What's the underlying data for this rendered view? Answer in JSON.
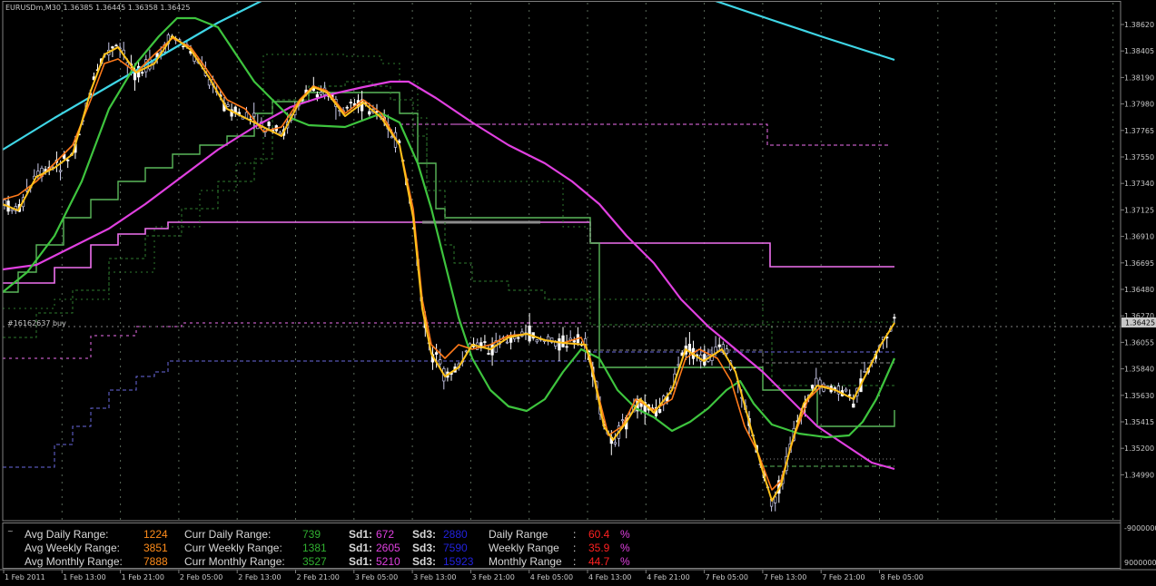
{
  "chart_header": "EURUSDm,M30  1.36385 1.36445 1.36358 1.36425",
  "order_label": "#16162637 buy",
  "current_price": "1.36425",
  "indicator_panel_marker": "~",
  "colors": {
    "background": "#000000",
    "bull_candle": "#c8c8e8",
    "bear_candle": "#ffffff",
    "cyan_ma": "#3fd6e6",
    "magenta_ma": "#e040e0",
    "green_ma": "#3ec43e",
    "yellow_ma": "#ffc21a",
    "orange_ma": "#ff7a1a",
    "pink_level": "#f070f0",
    "green_level": "#5ab85a",
    "dark_green_level": "#2e7a2e",
    "blue_level": "#6a6ae0",
    "grey_level": "#8c8c8c",
    "panel_orange": "#ff8c1a",
    "panel_green": "#30b030",
    "panel_magenta": "#e040e0",
    "panel_blue": "#2222dd",
    "panel_red": "#ff2020",
    "panel_label_white": "#d8d8d8"
  },
  "price_axis": {
    "labels": [
      "1.38620",
      "1.38405",
      "1.38190",
      "1.37980",
      "1.37765",
      "1.37550",
      "1.37340",
      "1.37125",
      "1.36910",
      "1.36695",
      "1.36480",
      "1.36270",
      "1.36055",
      "1.35840",
      "1.35630",
      "1.35415",
      "1.35200",
      "1.34990"
    ]
  },
  "indicator_axis": {
    "labels": [
      "-9000000",
      "9000000"
    ]
  },
  "time_axis": {
    "labels": [
      "1 Feb 2011",
      "1 Feb 13:00",
      "1 Feb 21:00",
      "2 Feb 05:00",
      "2 Feb 13:00",
      "2 Feb 21:00",
      "3 Feb 05:00",
      "3 Feb 13:00",
      "3 Feb 21:00",
      "4 Feb 05:00",
      "4 Feb 13:00",
      "4 Feb 21:00",
      "7 Feb 05:00",
      "7 Feb 13:00",
      "7 Feb 21:00",
      "8 Feb 05:00"
    ]
  },
  "panel": {
    "rows": [
      {
        "avg_label": "Avg Daily Range:",
        "avg_value": "1224",
        "curr_label": "Curr Daily Range:",
        "curr_value": "739",
        "sd1_label": "Sd1:",
        "sd1_value": "672",
        "sd3_label": "Sd3:",
        "sd3_value": "2880",
        "pct_label": "Daily Range",
        "pct_colon": ":",
        "pct_value": "60.4",
        "pct_unit": "%"
      },
      {
        "avg_label": "Avg Weekly Range:",
        "avg_value": "3851",
        "curr_label": "Curr Weekly Range:",
        "curr_value": "1381",
        "sd1_label": "Sd1:",
        "sd1_value": "2605",
        "sd3_label": "Sd3:",
        "sd3_value": "7590",
        "pct_label": "Weekly Range",
        "pct_colon": ":",
        "pct_value": "35.9",
        "pct_unit": "%"
      },
      {
        "avg_label": "Avg Monthly Range:",
        "avg_value": "7888",
        "curr_label": "Curr Monthly Range:",
        "curr_value": "3527",
        "sd1_label": "Sd1:",
        "sd1_value": "5210",
        "sd3_label": "Sd3:",
        "sd3_value": "15923",
        "pct_label": "Monthly Range",
        "pct_colon": ":",
        "pct_value": "44.7",
        "pct_unit": "%"
      }
    ]
  },
  "chart_data": {
    "type": "line",
    "symbol": "EURUSDm",
    "timeframe": "M30",
    "ylim": [
      1.3499,
      1.3862
    ],
    "series": [
      {
        "color": "#ffc21a",
        "x": [
          "1 Feb 2011",
          "1 Feb 13:00",
          "1 Feb 21:00",
          "2 Feb 05:00",
          "2 Feb 13:00",
          "2 Feb 21:00",
          "3 Feb 05:00",
          "3 Feb 13:00",
          "3 Feb 21:00",
          "4 Feb 05:00",
          "4 Feb 13:00",
          "4 Feb 21:00",
          "7 Feb 05:00",
          "7 Feb 13:00",
          "7 Feb 21:00",
          "8 Feb 05:00"
        ],
        "values": [
          1.3731,
          1.3821,
          1.3843,
          1.3815,
          1.3782,
          1.381,
          1.3784,
          1.363,
          1.3628,
          1.3625,
          1.357,
          1.3578,
          1.361,
          1.3525,
          1.359,
          1.364
        ]
      },
      {
        "color": "#3ec43e",
        "x": [
          "1 Feb 2011",
          "1 Feb 13:00",
          "1 Feb 21:00",
          "2 Feb 05:00",
          "2 Feb 13:00",
          "2 Feb 21:00",
          "3 Feb 05:00",
          "3 Feb 13:00",
          "3 Feb 21:00",
          "4 Feb 05:00",
          "4 Feb 13:00",
          "4 Feb 21:00",
          "7 Feb 05:00",
          "7 Feb 13:00",
          "7 Feb 21:00",
          "8 Feb 05:00"
        ],
        "values": [
          1.367,
          1.376,
          1.384,
          1.3855,
          1.38,
          1.3795,
          1.3795,
          1.37,
          1.3605,
          1.3625,
          1.359,
          1.3568,
          1.3592,
          1.358,
          1.3567,
          1.3615
        ]
      },
      {
        "color": "#e040e0",
        "x": [
          "1 Feb 2011",
          "1 Feb 13:00",
          "1 Feb 21:00",
          "2 Feb 05:00",
          "2 Feb 13:00",
          "2 Feb 21:00",
          "3 Feb 05:00",
          "3 Feb 13:00",
          "3 Feb 21:00",
          "4 Feb 05:00",
          "4 Feb 13:00",
          "4 Feb 21:00",
          "7 Feb 05:00",
          "7 Feb 13:00",
          "7 Feb 21:00",
          "8 Feb 05:00"
        ],
        "values": [
          1.3685,
          1.37,
          1.3725,
          1.3752,
          1.3775,
          1.3805,
          1.382,
          1.3788,
          1.376,
          1.3724,
          1.3685,
          1.3653,
          1.3624,
          1.3595,
          1.3562,
          1.354
        ]
      },
      {
        "color": "#3fd6e6",
        "x": [
          "1 Feb 2011",
          "1 Feb 13:00",
          "1 Feb 21:00",
          "2 Feb 05:00",
          "2 Feb 13:00",
          "2 Feb 21:00",
          "3 Feb 05:00",
          "3 Feb 13:00",
          "3 Feb 21:00",
          "4 Feb 05:00",
          "4 Feb 13:00",
          "4 Feb 21:00",
          "7 Feb 05:00",
          "7 Feb 13:00",
          "7 Feb 21:00",
          "8 Feb 05:00"
        ],
        "values": [
          1.377,
          1.3815,
          1.385,
          1.3878,
          1.39,
          1.392,
          1.3935,
          1.3945,
          1.3952,
          1.395,
          1.3935,
          1.391,
          1.388,
          1.3862,
          1.385,
          1.384
        ]
      }
    ]
  }
}
